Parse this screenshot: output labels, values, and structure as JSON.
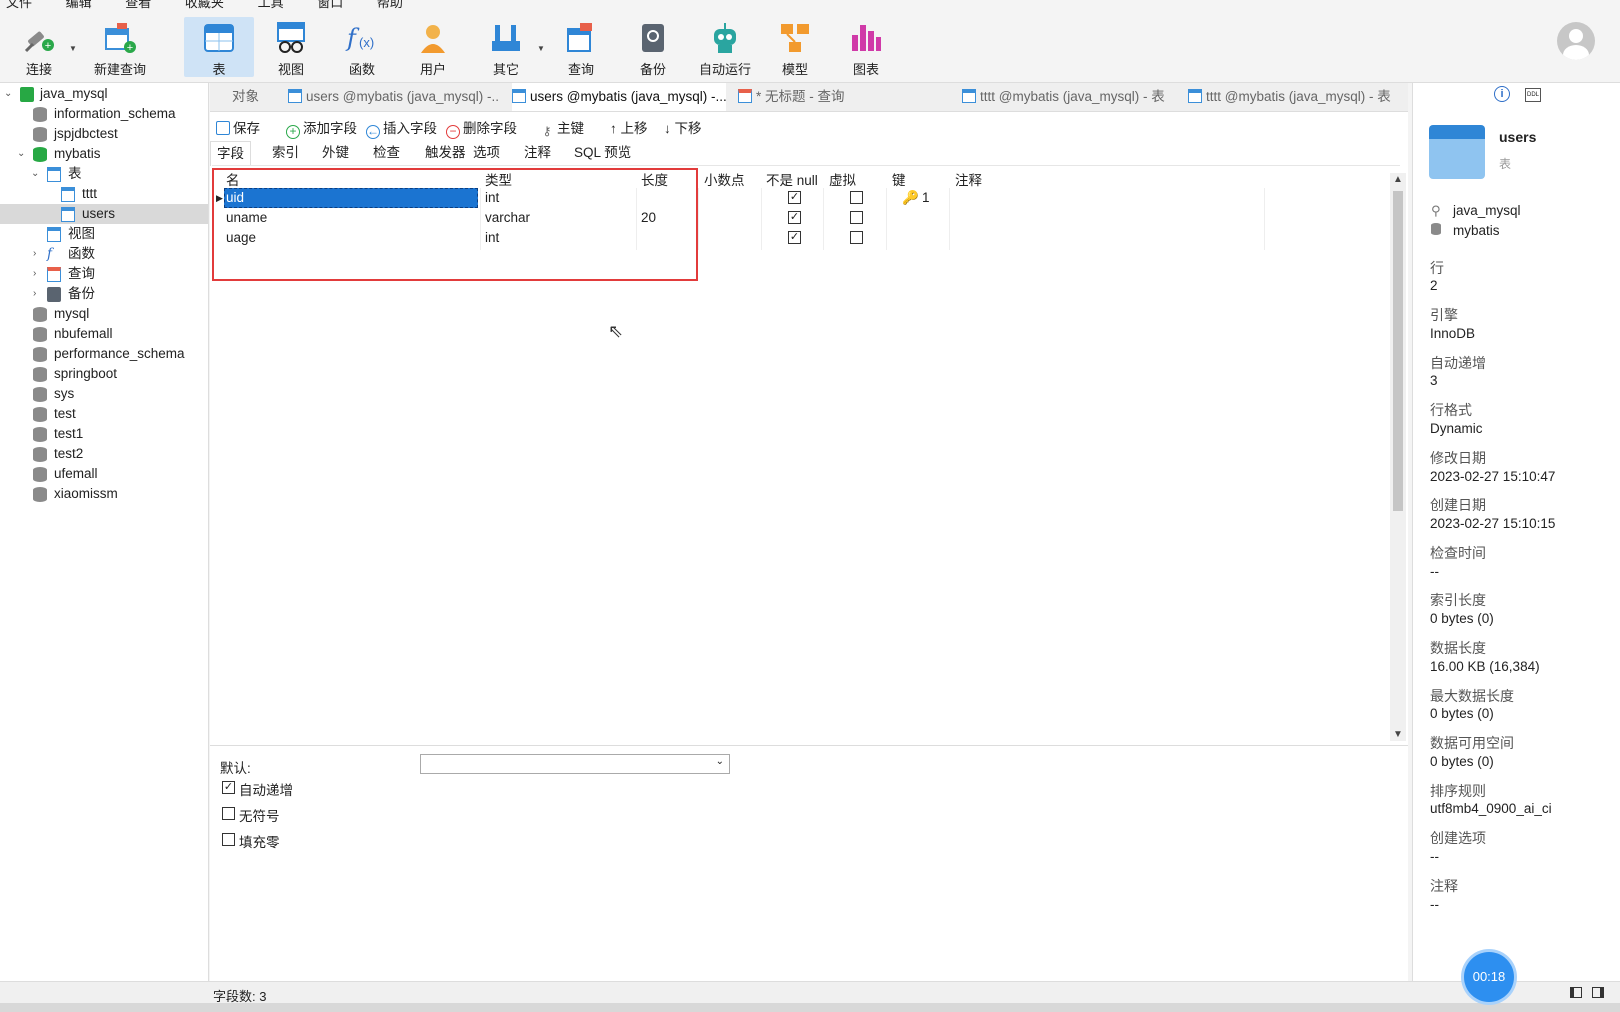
{
  "menu": [
    "文件",
    "编辑",
    "查看",
    "收藏夹",
    "工具",
    "窗口",
    "帮助"
  ],
  "toolbar": {
    "connect": "连接",
    "new_query": "新建查询",
    "table": "表",
    "view": "视图",
    "function": "函数",
    "user": "用户",
    "other": "其它",
    "query": "查询",
    "backup": "备份",
    "autorun": "自动运行",
    "model": "模型",
    "chart": "图表"
  },
  "sidebar": {
    "connection": "java_mysql",
    "databases": [
      "information_schema",
      "jspjdbctest",
      "mybatis"
    ],
    "mybatis_children": {
      "tables": "表",
      "table_items": [
        "tttt",
        "users"
      ],
      "views": "视图",
      "functions": "函数",
      "queries": "查询",
      "backups": "备份"
    },
    "other_databases": [
      "mysql",
      "nbufemall",
      "performance_schema",
      "springboot",
      "sys",
      "test",
      "test1",
      "test2",
      "ufemall",
      "xiaomissm"
    ]
  },
  "tabs": {
    "objects": "对象",
    "t1": "users @mybatis (java_mysql) -...",
    "t2": "users @mybatis (java_mysql) -...",
    "t3": "* 无标题 - 查询",
    "t4": "tttt @mybatis (java_mysql) - 表",
    "t5": "tttt @mybatis (java_mysql) - 表"
  },
  "subtoolbar": {
    "save": "保存",
    "add_field": "添加字段",
    "insert_field": "插入字段",
    "delete_field": "删除字段",
    "primary_key": "主键",
    "move_up": "上移",
    "move_down": "下移"
  },
  "subtabs": [
    "字段",
    "索引",
    "外键",
    "检查",
    "触发器",
    "选项",
    "注释",
    "SQL 预览"
  ],
  "grid": {
    "headers": {
      "name": "名",
      "type": "类型",
      "length": "长度",
      "decimal": "小数点",
      "not_null": "不是 null",
      "virtual": "虚拟",
      "key": "键",
      "comment": "注释"
    },
    "rows": [
      {
        "name": "uid",
        "type": "int",
        "length": "",
        "not_null": true,
        "virtual": false,
        "key": "1"
      },
      {
        "name": "uname",
        "type": "varchar",
        "length": "20",
        "not_null": true,
        "virtual": false,
        "key": ""
      },
      {
        "name": "uage",
        "type": "int",
        "length": "",
        "not_null": true,
        "virtual": false,
        "key": ""
      }
    ]
  },
  "props": {
    "default_label": "默认:",
    "auto_increment": "自动递增",
    "unsigned": "无符号",
    "zerofill": "填充零"
  },
  "status": {
    "field_count": "字段数: 3"
  },
  "info": {
    "name": "users",
    "kind": "表",
    "connection": "java_mysql",
    "database": "mybatis",
    "items": [
      {
        "k": "行",
        "v": "2"
      },
      {
        "k": "引擎",
        "v": "InnoDB"
      },
      {
        "k": "自动递增",
        "v": "3"
      },
      {
        "k": "行格式",
        "v": "Dynamic"
      },
      {
        "k": "修改日期",
        "v": "2023-02-27 15:10:47"
      },
      {
        "k": "创建日期",
        "v": "2023-02-27 15:10:15"
      },
      {
        "k": "检查时间",
        "v": "--"
      },
      {
        "k": "索引长度",
        "v": "0 bytes (0)"
      },
      {
        "k": "数据长度",
        "v": "16.00 KB (16,384)"
      },
      {
        "k": "最大数据长度",
        "v": "0 bytes (0)"
      },
      {
        "k": "数据可用空间",
        "v": "0 bytes (0)"
      },
      {
        "k": "排序规则",
        "v": "utf8mb4_0900_ai_ci"
      },
      {
        "k": "创建选项",
        "v": "--"
      },
      {
        "k": "注释",
        "v": "--"
      }
    ]
  },
  "timer": "00:18"
}
